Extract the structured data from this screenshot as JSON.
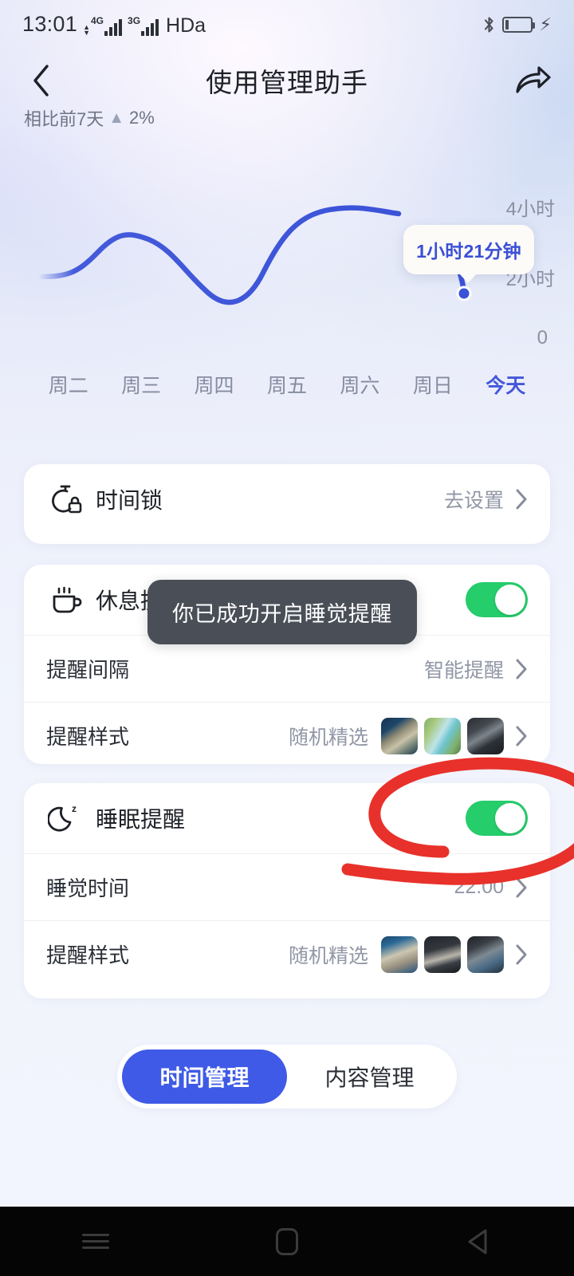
{
  "status_bar": {
    "time": "13:01",
    "network_1": "4G",
    "network_2": "3G",
    "hd_label": "HDa",
    "bluetooth_icon": "bluetooth-icon",
    "battery_icon": "battery-icon",
    "charging_icon": "charging-bolt-icon"
  },
  "app_bar": {
    "back_icon": "back-chevron-icon",
    "title": "使用管理助手",
    "share_icon": "share-icon"
  },
  "summary": {
    "compare_text": "相比前7天",
    "trend_direction": "up",
    "trend_value": "2%"
  },
  "chart_data": {
    "type": "line",
    "title": "",
    "xlabel": "",
    "ylabel": "",
    "categories": [
      "周二",
      "周三",
      "周四",
      "周五",
      "周六",
      "周日",
      "今天"
    ],
    "values": [
      1.45,
      2.35,
      1.95,
      0.75,
      2.6,
      3.55,
      1.35
    ],
    "ytick_labels": [
      "4小时",
      "2小时",
      "0"
    ],
    "ytick_values": [
      4,
      2,
      0
    ],
    "ylim": [
      0,
      4.4
    ],
    "grid": false,
    "legend": false,
    "line_color": "#3b53d8",
    "selected_index": 6,
    "selected_label": "今天",
    "tooltip": "1小时21分钟",
    "tooltip_value_hours": 1.35
  },
  "time_lock_card": {
    "icon": "stopwatch-lock-icon",
    "title": "时间锁",
    "action_label": "去设置",
    "chevron_icon": "chevron-right-icon"
  },
  "break_reminder_card": {
    "icon": "coffee-cup-icon",
    "title": "休息提醒",
    "toggle_state": "on",
    "rows": [
      {
        "label": "提醒间隔",
        "value": "智能提醒",
        "chevron_icon": "chevron-right-icon"
      },
      {
        "label": "提醒样式",
        "value": "随机精选",
        "chevron_icon": "chevron-right-icon",
        "thumbnails": [
          "coastal-cliff-thumbnail",
          "green-river-thumbnail",
          "rocky-shore-thumbnail"
        ]
      }
    ]
  },
  "sleep_reminder_card": {
    "icon": "moon-sleep-icon",
    "title": "睡眠提醒",
    "toggle_state": "on",
    "rows": [
      {
        "label": "睡觉时间",
        "value": "22:00",
        "chevron_icon": "chevron-right-icon"
      },
      {
        "label": "提醒样式",
        "value": "随机精选",
        "chevron_icon": "chevron-right-icon",
        "thumbnails": [
          "rocky-coast-thumbnail",
          "dark-cliff-thumbnail",
          "night-shore-thumbnail"
        ]
      }
    ]
  },
  "toast": {
    "message": "你已成功开启睡觉提醒"
  },
  "annotation": {
    "shape": "red-circle-highlight",
    "color": "#e8312b",
    "target": "sleep-reminder-toggle"
  },
  "segmented_control": {
    "tabs": [
      {
        "label": "时间管理",
        "active": true
      },
      {
        "label": "内容管理",
        "active": false
      }
    ]
  },
  "nav_bar": {
    "recents_icon": "recents-icon",
    "home_icon": "home-icon",
    "back_icon": "nav-back-icon"
  },
  "colors": {
    "accent_blue": "#3f5ae6",
    "chart_line": "#3b53d8",
    "toggle_on": "#25ce6b",
    "annotation_red": "#e8312b",
    "toast_bg": "#4a4f57"
  }
}
